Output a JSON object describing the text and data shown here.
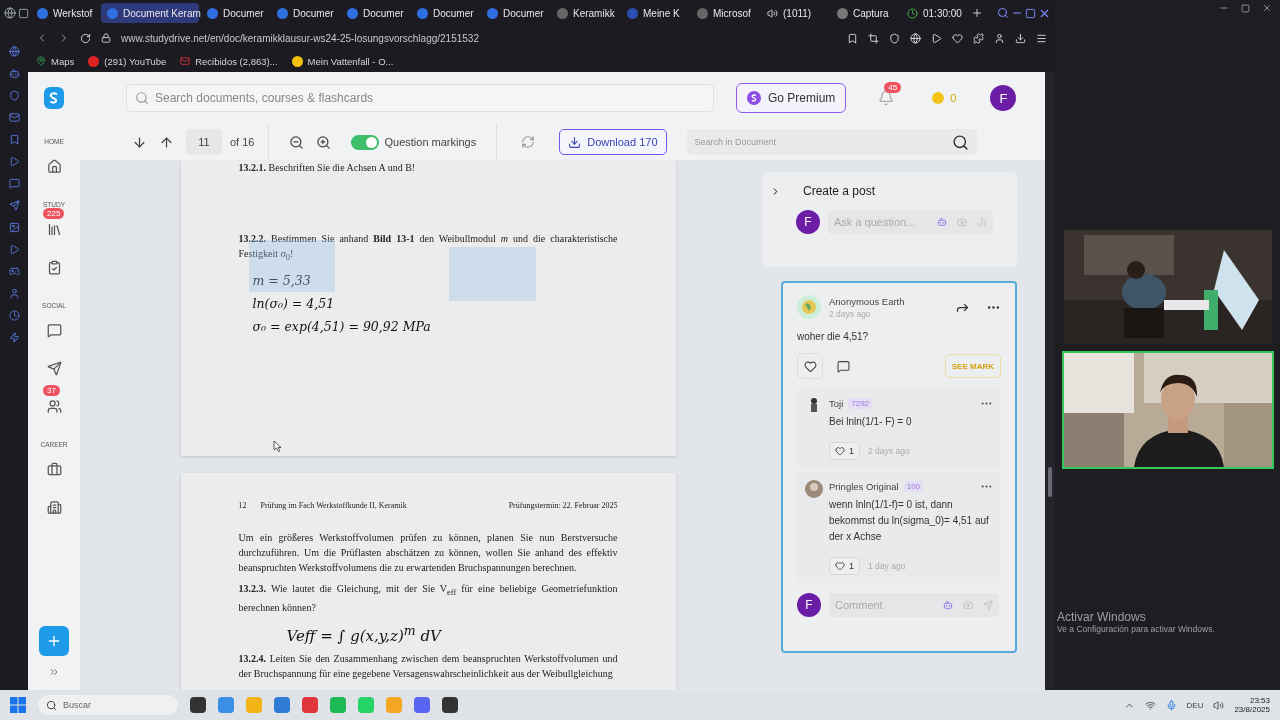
{
  "browser": {
    "tabs": [
      {
        "label": "Werkstof",
        "kind": "site",
        "selected": false
      },
      {
        "label": "Document Keram",
        "kind": "site",
        "selected": true
      },
      {
        "label": "Documer",
        "kind": "site",
        "selected": false
      },
      {
        "label": "Documer",
        "kind": "site",
        "selected": false
      },
      {
        "label": "Documer",
        "kind": "site",
        "selected": false
      },
      {
        "label": "Documer",
        "kind": "site",
        "selected": false
      },
      {
        "label": "Documer",
        "kind": "site",
        "selected": false
      },
      {
        "label": "Keramikk",
        "kind": "web",
        "selected": false
      },
      {
        "label": "Meine K",
        "kind": "bank",
        "selected": false
      },
      {
        "label": "Microsof",
        "kind": "web",
        "selected": false
      },
      {
        "label": "(1011)",
        "kind": "video",
        "selected": false
      },
      {
        "label": "Captura",
        "kind": "capture",
        "selected": false
      },
      {
        "label": "01:30:00",
        "kind": "timer",
        "selected": false
      }
    ],
    "url": "www.studydrive.net/en/doc/keramikklausur-ws24-25-losungsvorschlagg/2151532",
    "bookmarks": [
      {
        "label": "Maps",
        "kind": "maps"
      },
      {
        "label": "(291) YouTube",
        "kind": "video"
      },
      {
        "label": "Recibidos (2,863)...",
        "kind": "mail"
      },
      {
        "label": "Mein Vattenfall - O...",
        "kind": "energy"
      }
    ]
  },
  "site": {
    "search_placeholder": "Search documents, courses & flashcards",
    "premium": "Go Premium",
    "notifications": "45",
    "coins": "0",
    "avatar": "F"
  },
  "nav": [
    {
      "kind": "heading",
      "label": "HOME"
    },
    {
      "kind": "home"
    },
    {
      "kind": "heading",
      "label": "STUDY"
    },
    {
      "kind": "library",
      "badge": "225"
    },
    {
      "kind": "tasks"
    },
    {
      "kind": "heading",
      "label": "SOCIAL"
    },
    {
      "kind": "chat"
    },
    {
      "kind": "send"
    },
    {
      "kind": "groups",
      "badge": "37"
    },
    {
      "kind": "heading",
      "label": "CAREER"
    },
    {
      "kind": "jobs"
    },
    {
      "kind": "companies"
    }
  ],
  "viewer": {
    "page": "11",
    "of": "of 16",
    "question_markings": {
      "label": "Question markings",
      "on": true
    },
    "download": "Download 170",
    "search_placeholder": "Search in Document"
  },
  "document": {
    "pages": [
      {
        "blocks": [
          {
            "kind": "paragraph",
            "text": "**13.2.1.** Beschriften Sie die Achsen A und B!"
          },
          {
            "kind": "gap"
          },
          {
            "kind": "paragraph",
            "text": "**13.2.2.** Bestimmen Sie anhand **Bild 13-1** den Weibullmodul *m* und die charakteristische Festigkeit σ$_{0}$!"
          },
          {
            "kind": "handwriting",
            "text": "m = 5,33"
          },
          {
            "kind": "handwriting",
            "text": "ln(σ₀) =  4,51"
          },
          {
            "kind": "handwriting",
            "text": "σ₀  =  exp(4,51) =   90,92 MPa"
          }
        ]
      },
      {
        "header": {
          "number": "12",
          "title": "Prüfung im Fach Werkstoffkunde II, Keramik",
          "date": "Prüfungstermin: 22. Februar 2025"
        },
        "blocks": [
          {
            "kind": "paragraph",
            "text": "Um ein größeres Werkstoffvolumen prüfen zu können, planen Sie nun Berstversuche durchzuführen. Um die Prüflasten abschätzen zu können, wollen Sie anhand des effektiv beanspruchten Werkstoffvolumens die zu erwartenden Bruchspannungen berechnen."
          },
          {
            "kind": "paragraph",
            "text": "**13.2.3.** Wie lautet die Gleichung, mit der Sie V$_{eff}$ für eine beliebige Geometriefunktion berechnen können?"
          },
          {
            "kind": "handwriting",
            "text": "Veff = ∫ g(x,y,z)$^{m}$ dV"
          },
          {
            "kind": "paragraph",
            "text": "**13.2.4.** Leiten Sie den Zusammenhang zwischen dem beanspruchten Werkstoffvolumen und der Bruchspannung für eine gegebene Versagenswahrscheinlichkeit aus der Weibullgleichung"
          }
        ]
      }
    ]
  },
  "create_post": {
    "title": "Create a post",
    "avatar": "F",
    "placeholder": "Ask a question..."
  },
  "post": {
    "author": "Anonymous Earth",
    "time": "2 days ago",
    "text": "woher die 4,51?",
    "see_mark": "SEE MARK",
    "replies": [
      {
        "author": "Toji",
        "score": "7292",
        "text": "Bei lnln(1/1- F) = 0",
        "likes": "1",
        "time": "2 days ago"
      },
      {
        "author": "Pringles Original",
        "score": "100",
        "text": "wenn lnln(1/1-f)= 0 ist, dann bekommst du ln(sigma_0)= 4,51 auf der x Achse",
        "likes": "1",
        "time": "1 day ago"
      }
    ],
    "comment_avatar": "F",
    "comment_placeholder": "Comment"
  },
  "video_tiles": [
    {
      "kind": "picture",
      "selected": false
    },
    {
      "kind": "picture",
      "selected": true
    }
  ],
  "windows_notice": {
    "title": "Activar Windows",
    "text": "Ve a Configuración para activar Windows."
  },
  "taskbar": {
    "search_placeholder": "Buscar",
    "language": "DEU",
    "time": "23:53",
    "date": "23/8/2025"
  }
}
